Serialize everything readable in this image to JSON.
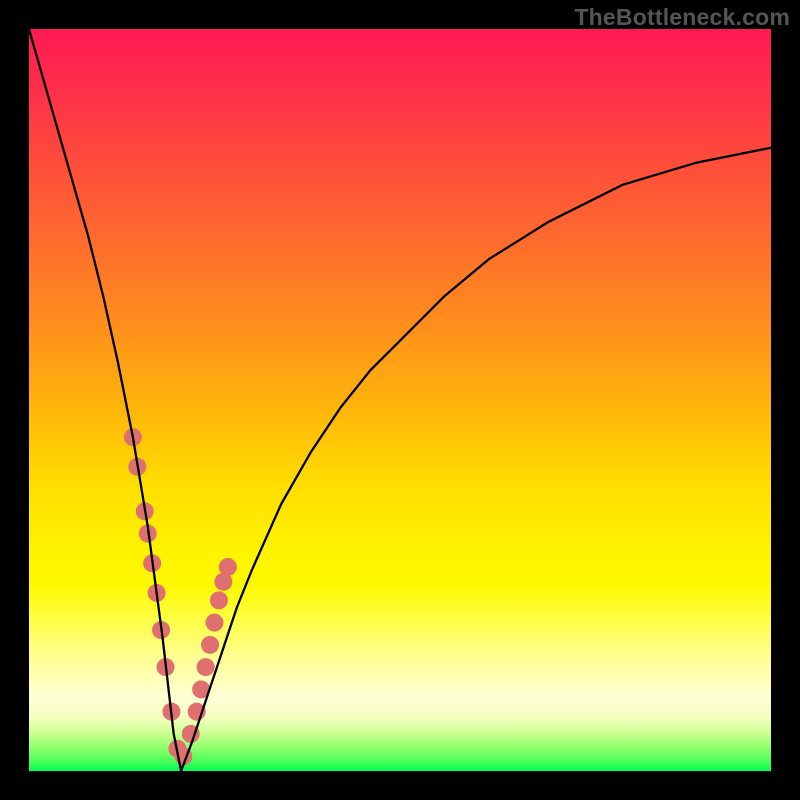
{
  "watermark": "TheBottleneck.com",
  "chart_data": {
    "type": "line",
    "title": "",
    "xlabel": "",
    "ylabel": "",
    "xlim": [
      0,
      100
    ],
    "ylim": [
      0,
      100
    ],
    "background": "gradient-red-to-green",
    "series": [
      {
        "name": "main-curve",
        "color": "#000000",
        "x": [
          0,
          2,
          4,
          6,
          8,
          10,
          12,
          14,
          16,
          18,
          19.5,
          20.5,
          22,
          24,
          26,
          28,
          30,
          34,
          38,
          42,
          46,
          50,
          56,
          62,
          70,
          80,
          90,
          100
        ],
        "y": [
          100,
          93,
          86,
          79,
          72,
          64,
          55,
          45,
          33,
          18,
          5,
          0,
          4,
          10,
          16,
          22,
          27,
          36,
          43,
          49,
          54,
          58,
          64,
          69,
          74,
          79,
          82,
          84
        ]
      },
      {
        "name": "marker-dots",
        "color": "#e07070",
        "shape": "circle-large",
        "x": [
          14.0,
          14.6,
          15.6,
          16.0,
          16.6,
          17.2,
          17.8,
          18.4,
          19.2,
          20.0,
          20.8,
          21.8,
          22.6,
          23.2,
          23.8,
          24.4,
          25.0,
          25.6,
          26.2,
          26.8
        ],
        "y": [
          45.0,
          41.0,
          35.0,
          32.0,
          28.0,
          24.0,
          19.0,
          14.0,
          8.0,
          3.0,
          2.0,
          5.0,
          8.0,
          11.0,
          14.0,
          17.0,
          20.0,
          23.0,
          25.5,
          27.5
        ]
      }
    ]
  }
}
